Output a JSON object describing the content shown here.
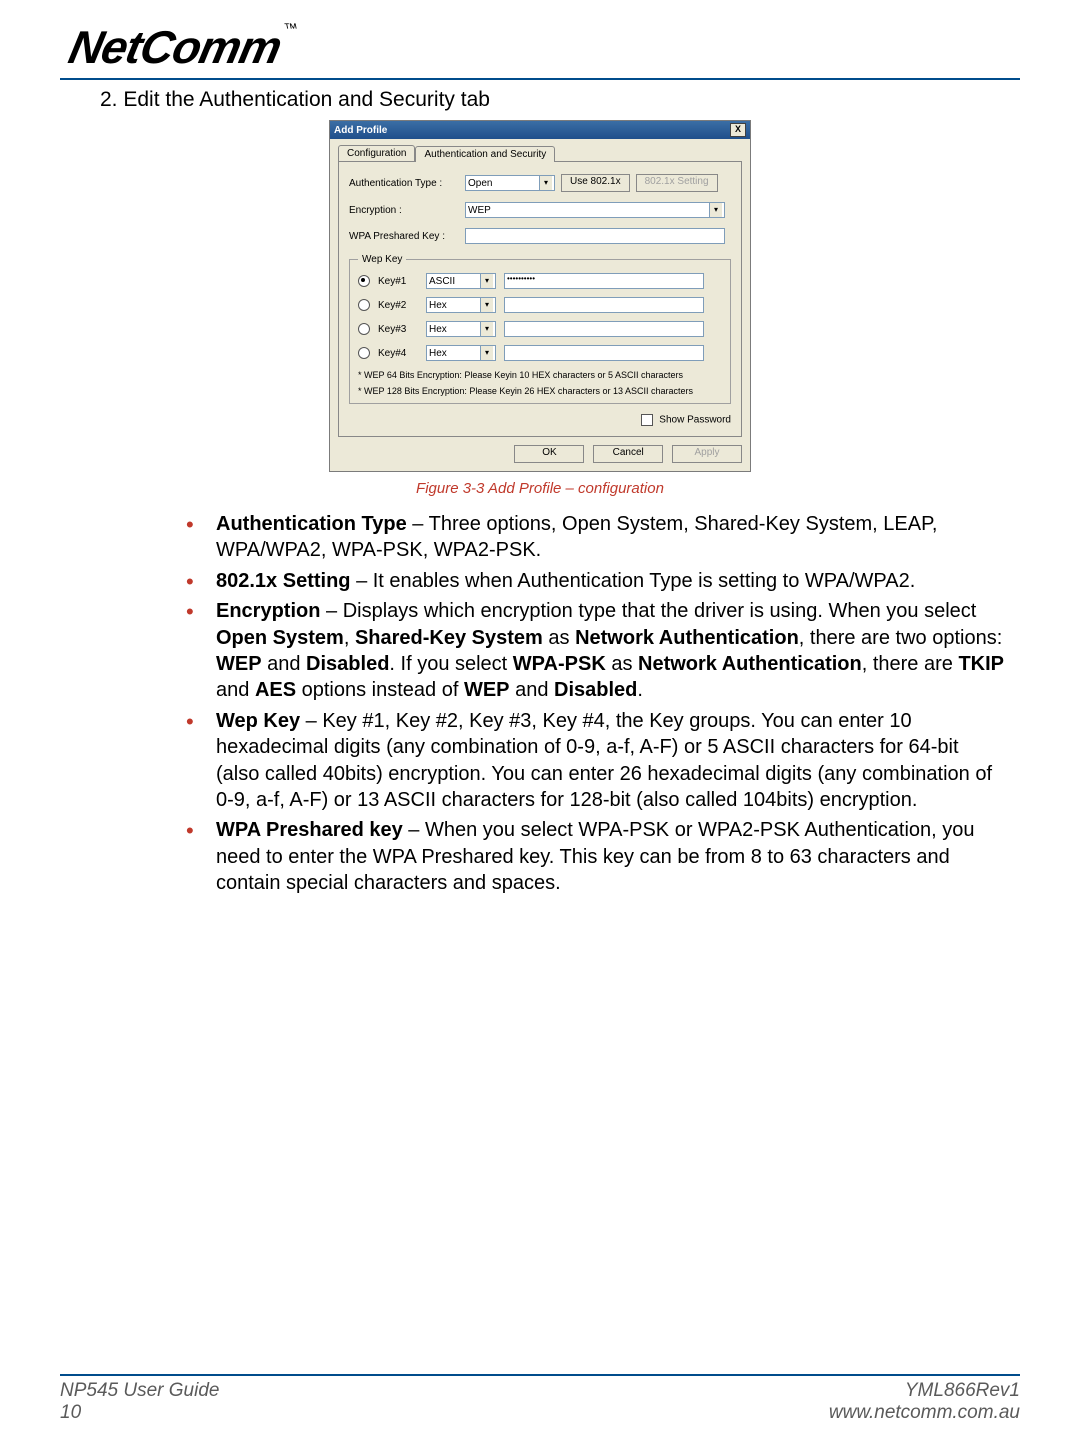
{
  "logo": {
    "text": "NetComm",
    "tm": "™"
  },
  "step": "2. Edit the Authentication and Security tab",
  "dialog": {
    "title": "Add Profile",
    "close": "X",
    "tabs": {
      "configuration": "Configuration",
      "authsec": "Authentication and Security"
    },
    "auth_type_label": "Authentication Type :",
    "auth_type_value": "Open",
    "use8021x": "Use 802.1x",
    "setting8021x": "802.1x Setting",
    "encryption_label": "Encryption :",
    "encryption_value": "WEP",
    "wpa_label": "WPA Preshared Key :",
    "wep_legend": "Wep Key",
    "keys": [
      {
        "label": "Key#1",
        "format": "ASCII",
        "value": "••••••••••",
        "checked": true
      },
      {
        "label": "Key#2",
        "format": "Hex",
        "value": "",
        "checked": false
      },
      {
        "label": "Key#3",
        "format": "Hex",
        "value": "",
        "checked": false
      },
      {
        "label": "Key#4",
        "format": "Hex",
        "value": "",
        "checked": false
      }
    ],
    "note1": "* WEP 64 Bits Encryption:  Please Keyin 10 HEX characters or 5 ASCII characters",
    "note2": "* WEP 128 Bits Encryption:  Please Keyin 26 HEX characters or 13 ASCII characters",
    "show_password": "Show Password",
    "ok": "OK",
    "cancel": "Cancel",
    "apply": "Apply"
  },
  "caption": "Figure 3-3 Add Profile – configuration",
  "bullets": {
    "b1_lead": "Authentication Type",
    "b1_text": " – Three options, Open System, Shared-Key System, LEAP, WPA/WPA2, WPA-PSK, WPA2-PSK.",
    "b2_lead": "802.1x Setting",
    "b2_text": " – It enables when Authentication Type is setting to WPA/WPA2.",
    "b3_lead": "Encryption",
    "b3_t1": " – Displays which encryption type that the driver is using. When you select ",
    "b3_b1": "Open System",
    "b3_t2": ", ",
    "b3_b2": "Shared-Key System",
    "b3_t3": " as ",
    "b3_b3": "Network Authentication",
    "b3_t4": ", there are two options: ",
    "b3_b4": "WEP",
    "b3_t5": " and ",
    "b3_b5": "Disabled",
    "b3_t6": ". If you select ",
    "b3_b6": "WPA-PSK",
    "b3_t7": " as ",
    "b3_b7": "Network Authentication",
    "b3_t8": ", there are ",
    "b3_b8": "TKIP",
    "b3_t9": " and ",
    "b3_b9": "AES",
    "b3_t10": " options instead of ",
    "b3_b10": "WEP",
    "b3_t11": " and ",
    "b3_b11": "Disabled",
    "b3_t12": ".",
    "b4_lead": "Wep Key",
    "b4_text": " – Key #1, Key #2, Key #3, Key #4, the Key groups. You can enter 10 hexadecimal digits (any combination of 0-9, a-f, A-F) or 5 ASCII characters for 64-bit (also called 40bits) encryption. You can enter 26 hexadecimal digits (any combination of 0-9, a-f, A-F) or 13 ASCII characters for 128-bit (also called 104bits) encryption.",
    "b5_lead": "WPA Preshared key",
    "b5_text": " – When you select WPA-PSK or WPA2-PSK Authentication, you need to enter the WPA Preshared key. This key can be from 8 to 63 characters and contain special characters and spaces."
  },
  "footer": {
    "guide": "NP545 User Guide",
    "rev": "YML866Rev1",
    "page": "10",
    "url": "www.netcomm.com.au"
  }
}
